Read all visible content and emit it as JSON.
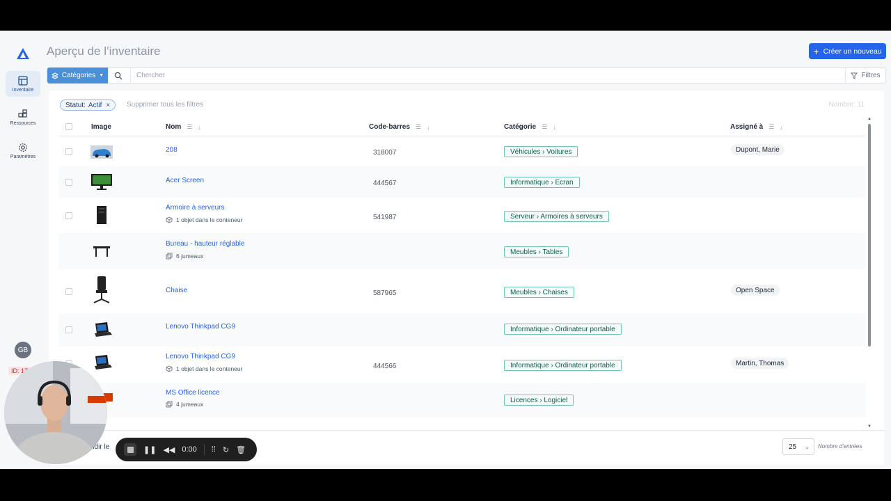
{
  "header": {
    "title": "Aperçu de l’inventaire",
    "create_label": "Créer un nouveau"
  },
  "sidebar": {
    "items": [
      {
        "label": "Inventaire",
        "icon": "grid-icon",
        "active": true
      },
      {
        "label": "Ressources",
        "icon": "blocks-icon",
        "active": false
      },
      {
        "label": "Paramètres",
        "icon": "gear-icon",
        "active": false
      }
    ],
    "avatar_initials": "GB",
    "id_badge": "ID: 17"
  },
  "search": {
    "categories_label": "Catégories",
    "placeholder": "Chercher",
    "filters_label": "Filtres"
  },
  "filters": {
    "status_key": "Statut:",
    "status_value": "Actif",
    "clear_label": "Supprimer tous les filtres",
    "count_label": "Nombre: 11"
  },
  "table": {
    "headers": {
      "image": "Image",
      "name": "Nom",
      "barcode": "Code-barres",
      "category": "Catégorie",
      "assignee": "Assigné à"
    },
    "rows": [
      {
        "name": "208",
        "sub": "",
        "barcode": "318007",
        "category": "Véhicules › Voitures",
        "assignee": "Dupont, Marie"
      },
      {
        "name": "Acer Screen",
        "sub": "",
        "barcode": "444567",
        "category": "Informatique › Ecran",
        "assignee": ""
      },
      {
        "name": "Armoire à serveurs",
        "sub": "1 objet dans le conteneur",
        "barcode": "541987",
        "category": "Serveur › Armoires à serveurs",
        "assignee": ""
      },
      {
        "name": "Bureau - hauteur réglable",
        "sub": "6 jumeaux",
        "barcode": "",
        "category": "Meubles › Tables",
        "assignee": ""
      },
      {
        "name": "Chaise",
        "sub": "",
        "barcode": "587965",
        "category": "Meubles › Chaises",
        "assignee": "Open Space"
      },
      {
        "name": "Lenovo Thinkpad CG9",
        "sub": "",
        "barcode": "",
        "category": "Informatique › Ordinateur portable",
        "assignee": ""
      },
      {
        "name": "Lenovo Thinkpad CG9",
        "sub": "1 objet dans le conteneur",
        "barcode": "444566",
        "category": "Informatique › Ordinateur portable",
        "assignee": "Martin, Thomas"
      },
      {
        "name": "MS Office licence",
        "sub": "4 jumeaux",
        "barcode": "",
        "category": "Licences › Logiciel",
        "assignee": ""
      }
    ]
  },
  "footer": {
    "left_text": "ndir le",
    "page_size": "25",
    "page_size_label": "Nombre d'entrées"
  },
  "player": {
    "time": "0:00"
  },
  "colors": {
    "accent": "#2563eb",
    "tag_border": "#6cc6b1",
    "tag_text": "#0f5e4e"
  }
}
